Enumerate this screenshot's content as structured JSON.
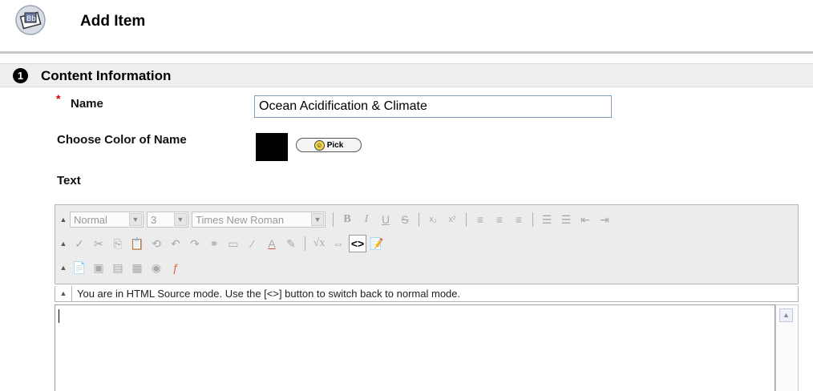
{
  "header": {
    "title": "Add Item",
    "icon": "add-item-icon"
  },
  "section": {
    "number": "1",
    "title": "Content Information"
  },
  "form": {
    "required_mark": "*",
    "name_label": "Name",
    "name_value": "Ocean Acidification & Climate",
    "color_label": "Choose Color of Name",
    "color_value": "#000000",
    "pick_label": "Pick",
    "text_label": "Text"
  },
  "editor": {
    "format_select": "Normal",
    "size_select": "3",
    "font_select": "Times New Roman",
    "status_text": "You are in HTML Source mode. Use the [<>] button to switch back to normal mode.",
    "html_source_button": "<>",
    "text_value": ""
  }
}
